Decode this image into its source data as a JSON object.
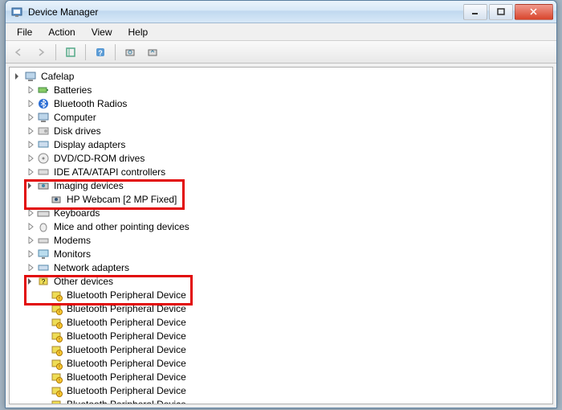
{
  "window": {
    "title": "Device Manager"
  },
  "menu": {
    "file": "File",
    "action": "Action",
    "view": "View",
    "help": "Help"
  },
  "tree": {
    "root": "Cafelap",
    "batteries": "Batteries",
    "bluetooth_radios": "Bluetooth Radios",
    "computer": "Computer",
    "disk_drives": "Disk drives",
    "display_adapters": "Display adapters",
    "dvd_cdrom": "DVD/CD-ROM drives",
    "ide_ata": "IDE ATA/ATAPI controllers",
    "imaging_devices": "Imaging devices",
    "hp_webcam": "HP Webcam [2 MP Fixed]",
    "keyboards": "Keyboards",
    "mice": "Mice and other pointing devices",
    "modems": "Modems",
    "monitors": "Monitors",
    "network_adapters": "Network adapters",
    "other_devices": "Other devices",
    "bluetooth_peripheral": "Bluetooth Peripheral Device"
  }
}
